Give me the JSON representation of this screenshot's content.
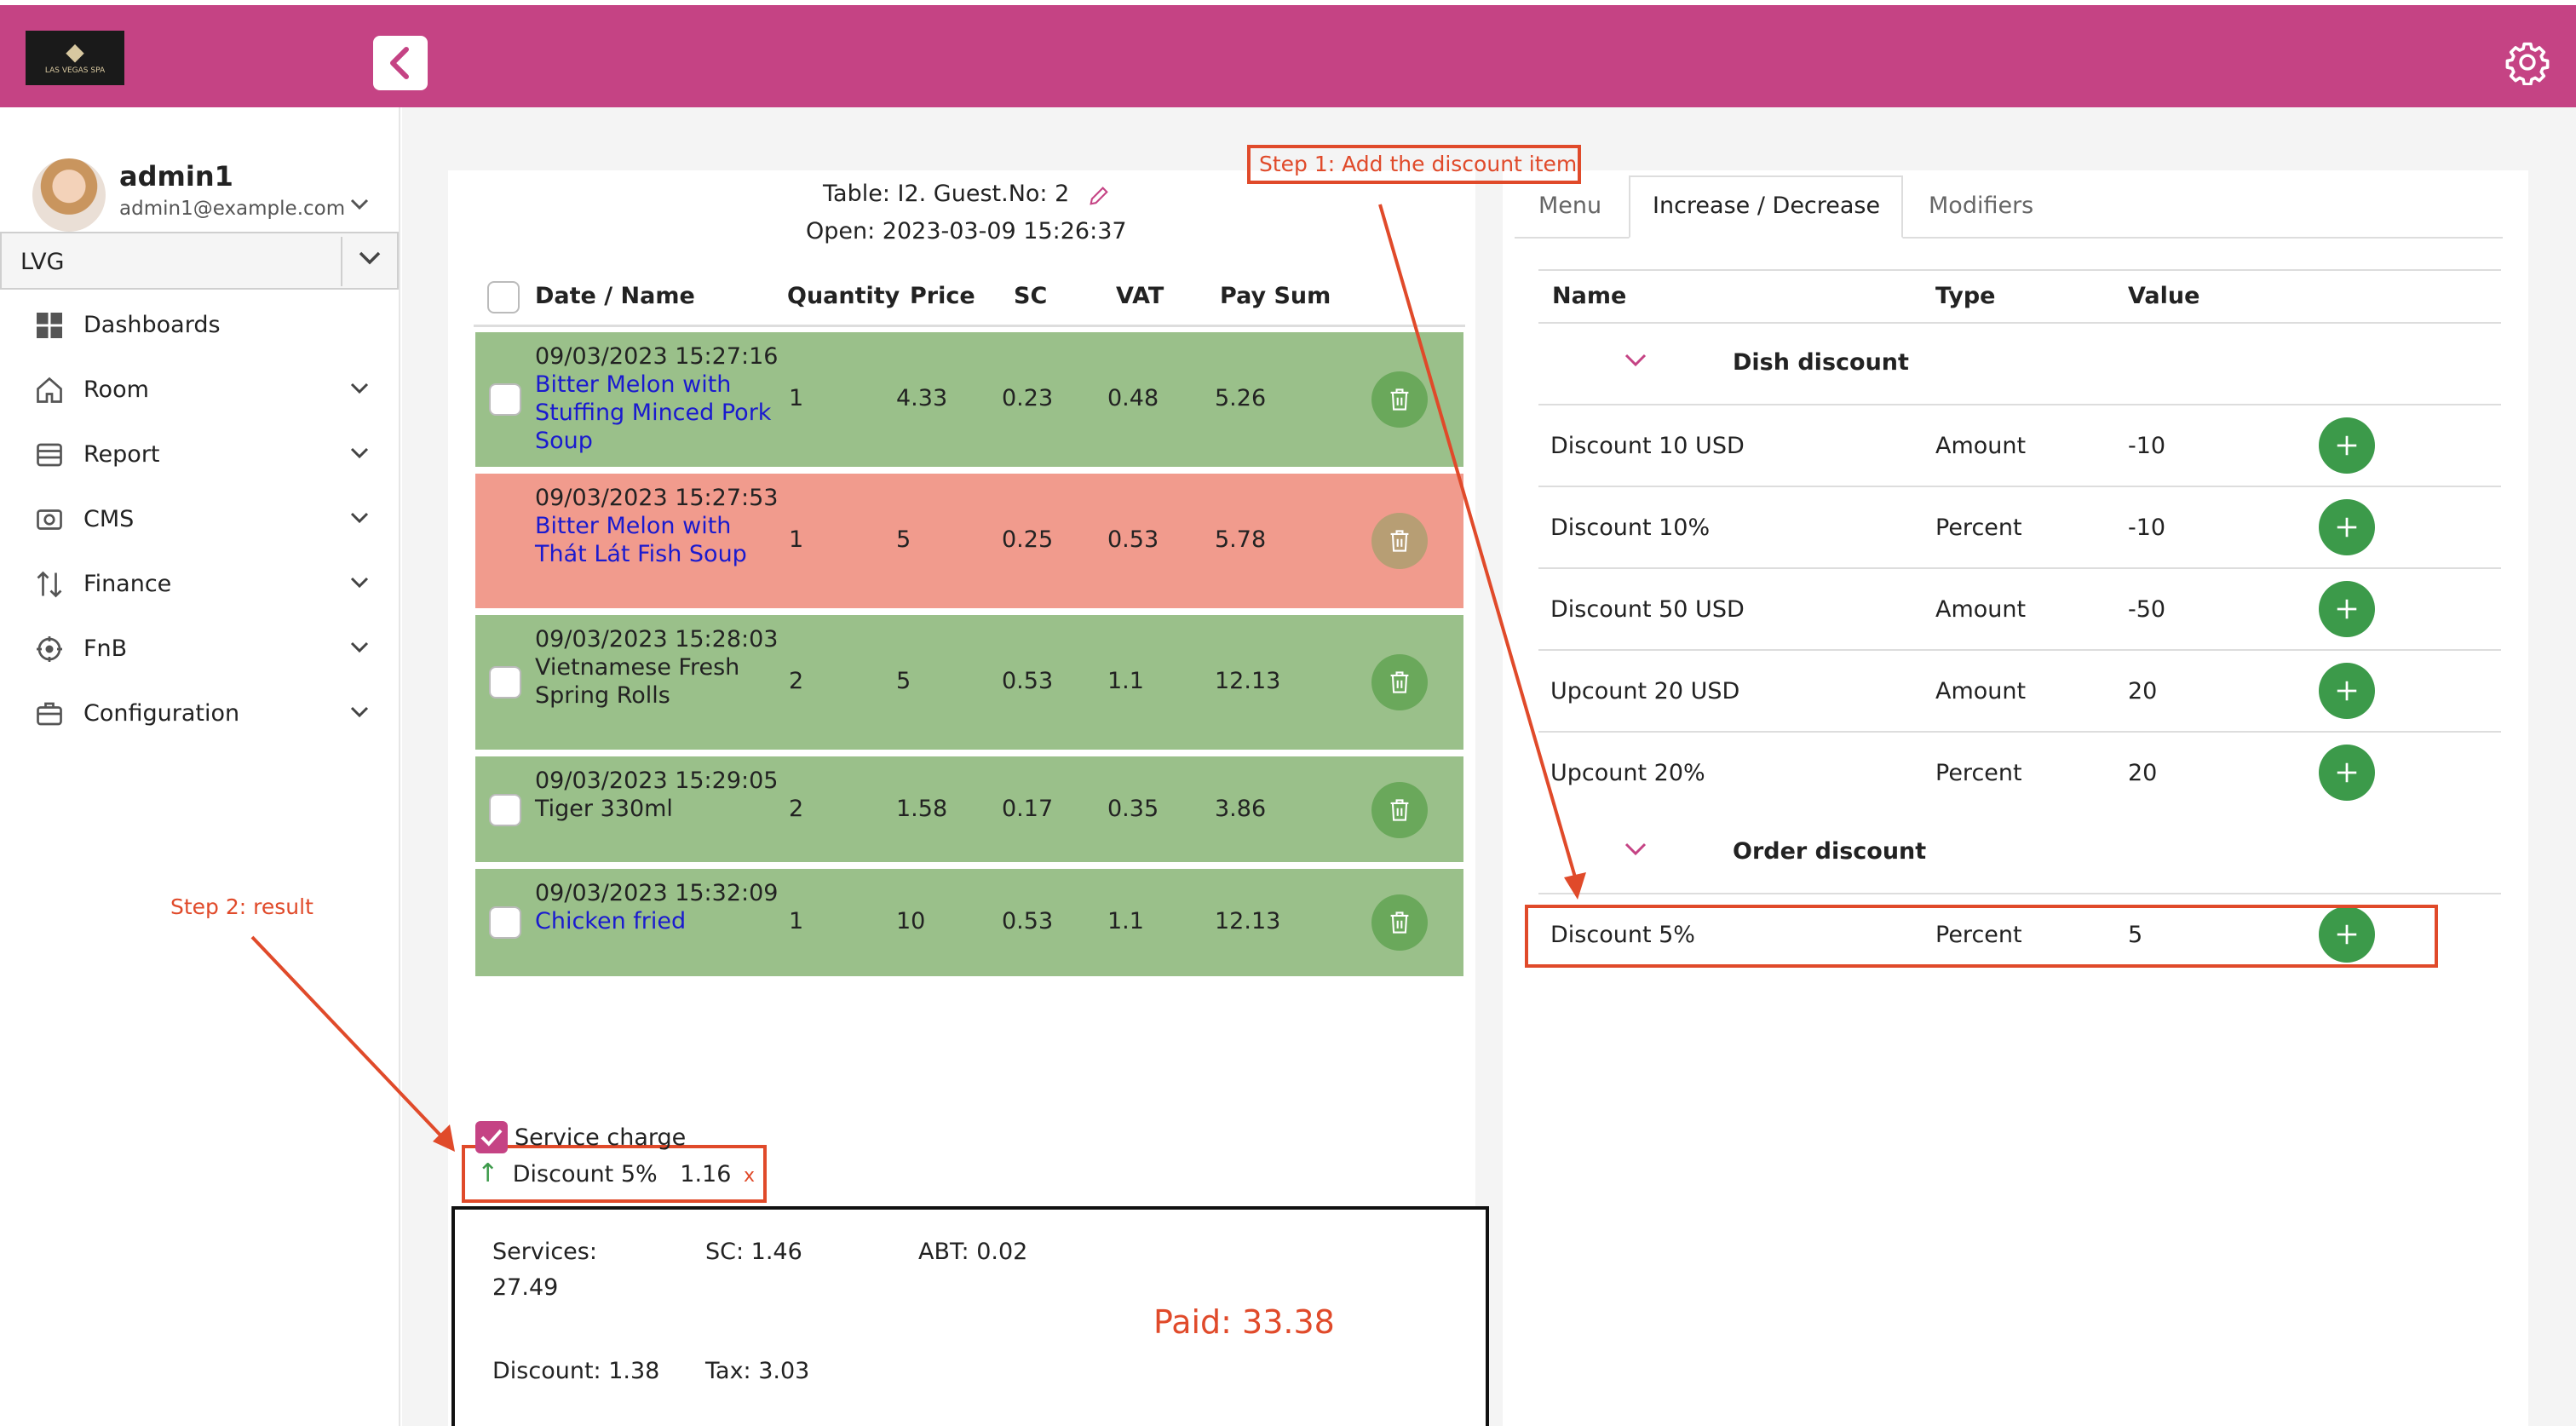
{
  "header": {
    "logo_text": "LAS VEGAS SPA",
    "collapse_icon": "chevron-left-icon",
    "settings_icon": "gear-icon",
    "brand_color": "#c54384"
  },
  "user": {
    "name": "admin1",
    "email": "admin1@example.com"
  },
  "store_select": {
    "value": "LVG"
  },
  "sidebar": {
    "items": [
      {
        "label": "Dashboards",
        "icon": "dashboard-icon",
        "expandable": false
      },
      {
        "label": "Room",
        "icon": "home-icon",
        "expandable": true
      },
      {
        "label": "Report",
        "icon": "report-icon",
        "expandable": true
      },
      {
        "label": "CMS",
        "icon": "cms-icon",
        "expandable": true
      },
      {
        "label": "Finance",
        "icon": "finance-icon",
        "expandable": true
      },
      {
        "label": "FnB",
        "icon": "fnb-icon",
        "expandable": true
      },
      {
        "label": "Configuration",
        "icon": "briefcase-icon",
        "expandable": true
      }
    ]
  },
  "order": {
    "table_line": "Table: I2. Guest.No: 2",
    "open_line": "Open: 2023-03-09 15:26:37",
    "columns": [
      "Date / Name",
      "Quantity",
      "Price",
      "SC",
      "VAT",
      "Pay Sum"
    ],
    "rows": [
      {
        "date": "09/03/2023 15:27:16",
        "name": "Bitter Melon with Stuffing Minced Pork Soup",
        "qty": "1",
        "price": "4.33",
        "sc": "0.23",
        "vat": "0.48",
        "sum": "5.26",
        "status": "green",
        "name_link": true
      },
      {
        "date": "09/03/2023 15:27:53",
        "name": "Bitter Melon with Thát Lát Fish Soup",
        "qty": "1",
        "price": "5",
        "sc": "0.25",
        "vat": "0.53",
        "sum": "5.78",
        "status": "red",
        "name_link": true
      },
      {
        "date": "09/03/2023 15:28:03",
        "name": "Vietnamese Fresh Spring Rolls",
        "qty": "2",
        "price": "5",
        "sc": "0.53",
        "vat": "1.1",
        "sum": "12.13",
        "status": "green",
        "name_link": false
      },
      {
        "date": "09/03/2023 15:29:05",
        "name": "Tiger 330ml",
        "qty": "2",
        "price": "1.58",
        "sc": "0.17",
        "vat": "0.35",
        "sum": "3.86",
        "status": "green",
        "name_link": false
      },
      {
        "date": "09/03/2023 15:32:09",
        "name": "Chicken fried",
        "qty": "1",
        "price": "10",
        "sc": "0.53",
        "vat": "1.1",
        "sum": "12.13",
        "status": "green",
        "name_link": true
      }
    ]
  },
  "tabs": [
    "Menu",
    "Increase / Decrease",
    "Modifiers"
  ],
  "discounts": {
    "columns": [
      "Name",
      "Type",
      "Value"
    ],
    "groups": [
      {
        "name": "Dish discount",
        "items": [
          {
            "name": "Discount 10 USD",
            "type": "Amount",
            "value": "-10"
          },
          {
            "name": "Discount 10%",
            "type": "Percent",
            "value": "-10"
          },
          {
            "name": "Discount 50 USD",
            "type": "Amount",
            "value": "-50"
          },
          {
            "name": "Upcount 20 USD",
            "type": "Amount",
            "value": "20"
          },
          {
            "name": "Upcount 20%",
            "type": "Percent",
            "value": "20"
          }
        ]
      },
      {
        "name": "Order discount",
        "items": [
          {
            "name": "Discount 5%",
            "type": "Percent",
            "value": "5"
          }
        ]
      }
    ]
  },
  "annotations": {
    "step1": "Step 1: Add the discount item",
    "step2": "Step 2: result",
    "color": "#e04a2a"
  },
  "bottom": {
    "service_charge_label": "Service charge",
    "applied_discount_name": "Discount 5%",
    "applied_discount_value": "1.16",
    "remove_label": "x",
    "services_label": "Services:",
    "services_value": "27.49",
    "sc": "SC: 1.46",
    "abt": "ABT: 0.02",
    "discount": "Discount: 1.38",
    "tax": "Tax: 3.03",
    "paid": "Paid: 33.38"
  }
}
